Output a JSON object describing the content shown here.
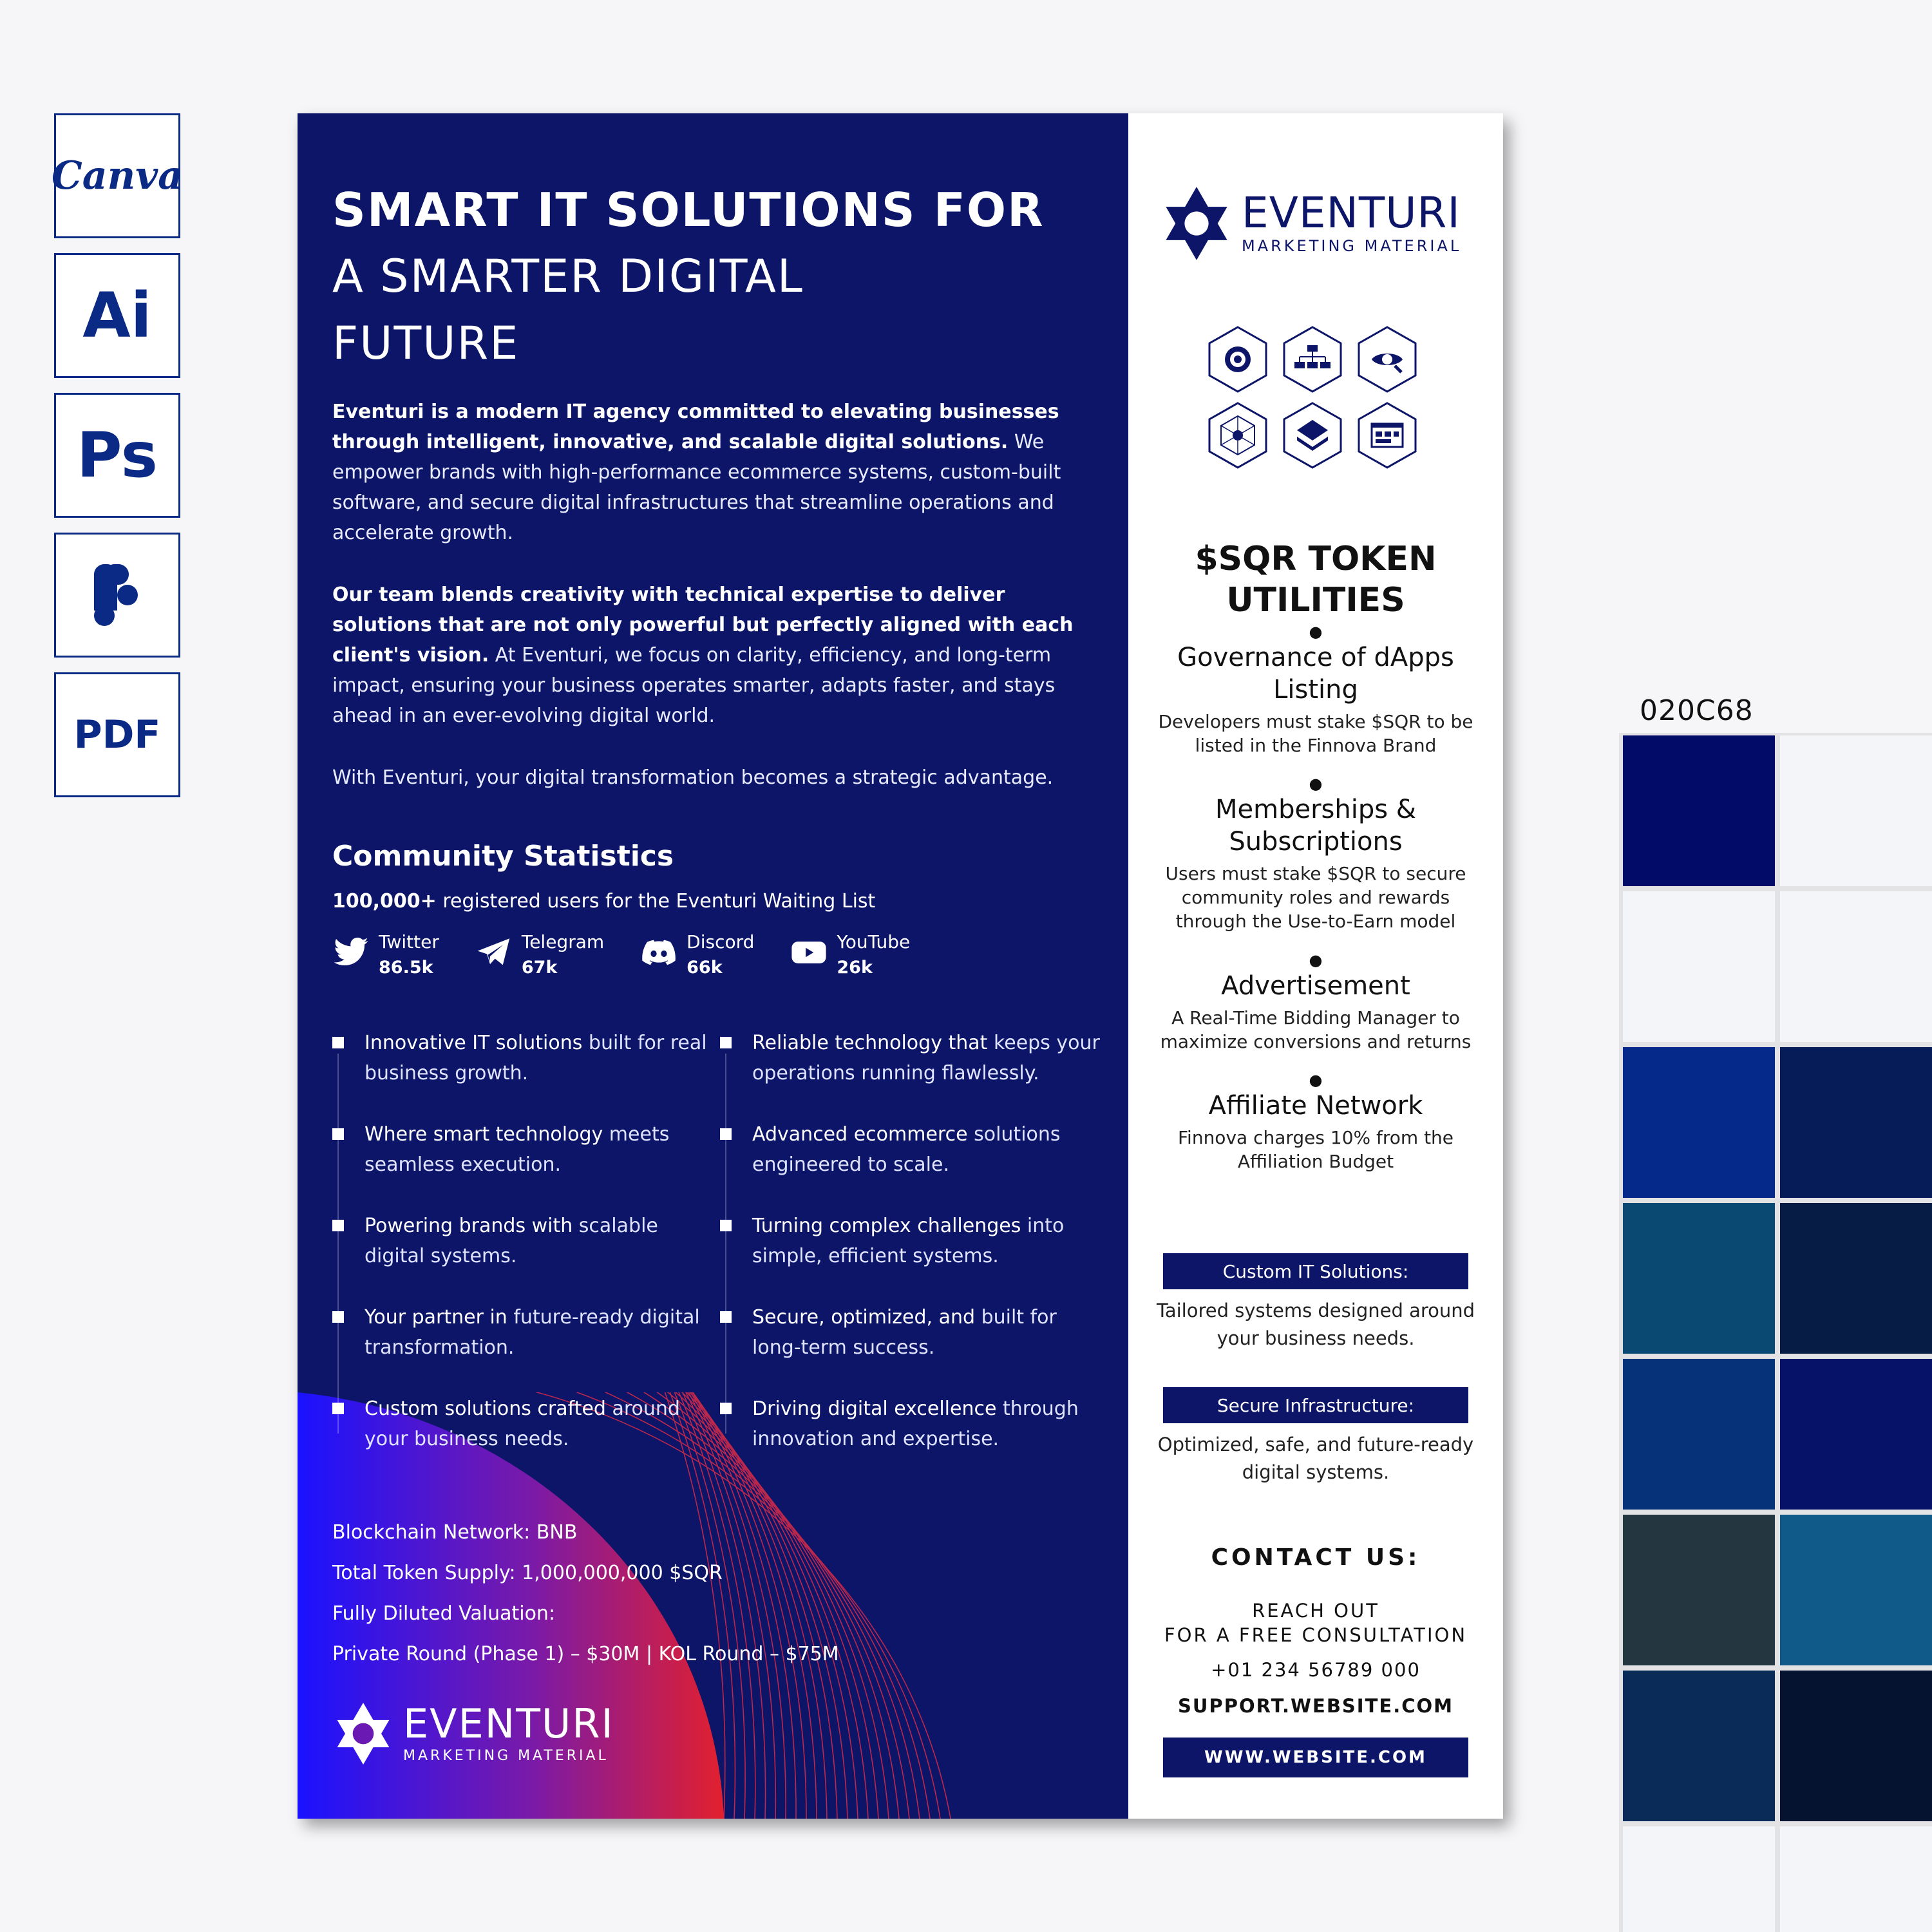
{
  "software_badges": [
    {
      "label": "Canva"
    },
    {
      "label": "Ai"
    },
    {
      "label": "Ps"
    },
    {
      "label": "",
      "icon": "figma-icon"
    },
    {
      "label": "PDF"
    }
  ],
  "flyer": {
    "colors": {
      "navy": "#0c1568",
      "accent_red": "#e2202e",
      "accent_blue": "#1a12ff"
    },
    "title": {
      "line1": "SMART IT SOLUTIONS FOR",
      "line2": "A SMARTER DIGITAL",
      "line3": "FUTURE"
    },
    "intro": {
      "p1_bold": "Eventuri is a modern IT agency committed to elevating businesses through intelligent, innovative, and scalable digital solutions.",
      "p1_rest": " We empower brands with high-performance ecommerce systems, custom-built software, and secure digital infrastructures that streamline operations and accelerate growth.",
      "p2_bold": "Our team blends creativity with technical expertise to deliver solutions that are not only powerful but perfectly aligned with each client's vision.",
      "p2_rest": " At Eventuri, we focus on clarity, efficiency, and long-term impact, ensuring your business operates smarter, adapts faster, and stays ahead in an ever-evolving digital world.",
      "p3": "With Eventuri, your digital transformation becomes a strategic advantage."
    },
    "community": {
      "title": "Community Statistics",
      "users_bold": "100,000+",
      "users_rest": " registered users for the Eventuri Waiting List",
      "socials": [
        {
          "name": "Twitter",
          "count": "86.5k",
          "icon": "twitter-icon"
        },
        {
          "name": "Telegram",
          "count": "67k",
          "icon": "telegram-icon"
        },
        {
          "name": "Discord",
          "count": "66k",
          "icon": "discord-icon"
        },
        {
          "name": "YouTube",
          "count": "26k",
          "icon": "youtube-icon"
        }
      ]
    },
    "bullets_left": [
      {
        "bold": "Innovative IT solutions",
        "rest": " built for real business growth."
      },
      {
        "bold": "Where smart technology",
        "rest": " meets seamless execution."
      },
      {
        "bold": "Powering brands with",
        "rest": " scalable digital systems."
      },
      {
        "bold": "Your partner in",
        "rest": " future-ready digital transformation."
      },
      {
        "bold": "Custom solutions crafted",
        "rest": " around your business needs."
      }
    ],
    "bullets_right": [
      {
        "bold": "Reliable technology that",
        "rest": " keeps your operations running flawlessly."
      },
      {
        "bold": "Advanced ecommerce",
        "rest": " solutions engineered to scale."
      },
      {
        "bold": "Turning complex challenges",
        "rest": " into simple, efficient systems."
      },
      {
        "bold": "Secure, optimized, and",
        "rest": " built for long-term success."
      },
      {
        "bold": "Driving digital excellence",
        "rest": " through innovation and expertise."
      }
    ],
    "facts": [
      "Blockchain Network: BNB",
      "Total Token Supply: 1,000,000,000 $SQR",
      "Fully Diluted Valuation:",
      "Private Round (Phase 1) – $30M | KOL Round – $75M"
    ],
    "logo": {
      "name": "EVENTURI",
      "tagline": "MARKETING MATERIAL"
    },
    "right": {
      "hex_icons": [
        "target-icon",
        "org-chart-icon",
        "eye-search-icon",
        "network-icon",
        "layers-icon",
        "dashboard-icon"
      ],
      "utilities_title_line1": "$SQR TOKEN",
      "utilities_title_line2": "UTILITIES",
      "utilities": [
        {
          "name": "Governance of dApps Listing",
          "desc": "Developers must stake $SQR to be listed in the Finnova Brand"
        },
        {
          "name": "Memberships & Subscriptions",
          "desc": "Users must stake $SQR to secure community roles and rewards through the Use-to-Earn model"
        },
        {
          "name": "Advertisement",
          "desc": "A Real-Time Bidding Manager to maximize conversions and returns"
        },
        {
          "name": "Affiliate Network",
          "desc": "Finnova charges 10% from the Affiliation Budget"
        }
      ],
      "services": [
        {
          "label": "Custom IT Solutions:",
          "desc": "Tailored systems designed around your business needs."
        },
        {
          "label": "Secure Infrastructure:",
          "desc": "Optimized, safe, and future-ready digital systems."
        }
      ],
      "contact": {
        "title": "CONTACT US:",
        "line1": "REACH OUT",
        "line2": "FOR A FREE CONSULTATION",
        "phone": "+01 234 56789 000",
        "email": "SUPPORT.WEBSITE.COM",
        "website": "WWW.WEBSITE.COM"
      }
    }
  },
  "palette": {
    "label": "020C68",
    "swatches": [
      "#020c68",
      "#f4f5f8",
      "#f4f5f8",
      "#f4f5f8",
      "#04298a",
      "#051c58",
      "#0a4a72",
      "#061c44",
      "#06327a",
      "#061268",
      "#243740",
      "#105a8a",
      "#0a2b58",
      "#061330",
      "#f4f5f8",
      "#f4f5f8"
    ]
  }
}
